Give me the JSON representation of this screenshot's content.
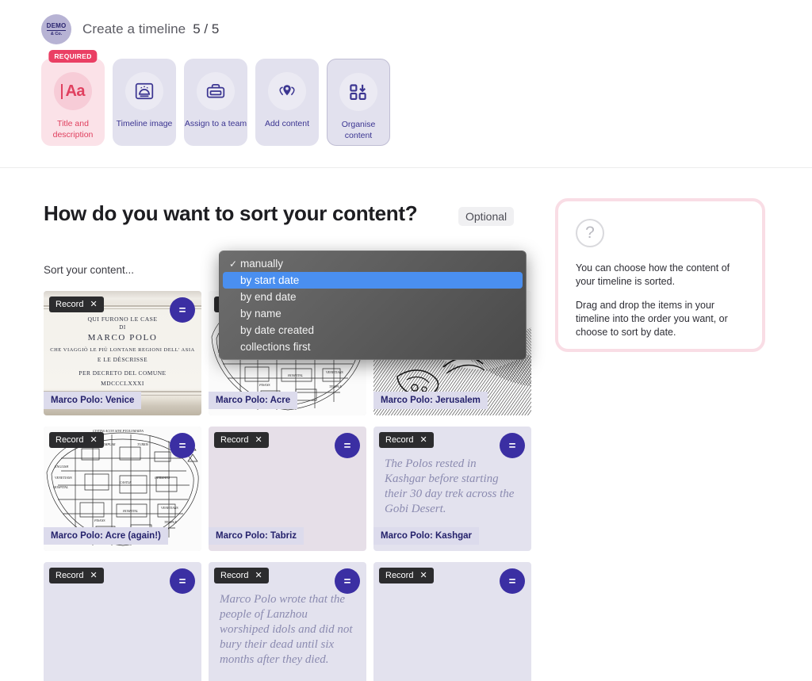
{
  "header": {
    "logo_demo": "DEMO",
    "logo_co": "& Co.",
    "title": "Create a timeline",
    "count": "5 / 5"
  },
  "steps": [
    {
      "label": "Title and description",
      "badge": "REQUIRED",
      "icon": "text-aa-icon",
      "state": "required"
    },
    {
      "label": "Timeline image",
      "badge": "",
      "icon": "image-sunrise-icon",
      "state": "default"
    },
    {
      "label": "Assign to a team",
      "badge": "",
      "icon": "briefcase-icon",
      "state": "default"
    },
    {
      "label": "Add content",
      "badge": "",
      "icon": "map-pins-icon",
      "state": "default"
    },
    {
      "label": "Organise content",
      "badge": "",
      "icon": "grid-download-icon",
      "state": "active"
    }
  ],
  "main": {
    "page_title": "How do you want to sort your content?",
    "optional_badge": "Optional",
    "sort_label": "Sort your content..."
  },
  "help": {
    "icon": "question-mark-icon",
    "paragraphs": [
      "You can choose how the content of your timeline is sorted.",
      "Drag and drop the items in your timeline into the order you want, or choose to sort by date."
    ]
  },
  "dropdown": {
    "open": true,
    "options": [
      {
        "label": "manually",
        "checked": true,
        "highlighted": false
      },
      {
        "label": "by start date",
        "checked": false,
        "highlighted": true
      },
      {
        "label": "by end date",
        "checked": false,
        "highlighted": false
      },
      {
        "label": "by name",
        "checked": false,
        "highlighted": false
      },
      {
        "label": "by date created",
        "checked": false,
        "highlighted": false
      },
      {
        "label": "collections first",
        "checked": false,
        "highlighted": false
      }
    ]
  },
  "cards": {
    "badge_label": "Record",
    "badge_close": "✕",
    "drag_handle_glyph": "=",
    "items": [
      {
        "caption": "Marco Polo: Venice",
        "art": "plaque",
        "quote": ""
      },
      {
        "caption": "Marco Polo: Acre",
        "art": "engrave-map-acre",
        "quote": ""
      },
      {
        "caption": "Marco Polo: Jerusalem",
        "art": "engrave-hatch",
        "quote": ""
      },
      {
        "caption": "Marco Polo: Acre (again!)",
        "art": "engrave-map-acre",
        "quote": ""
      },
      {
        "caption": "Marco Polo: Tabriz",
        "art": "blank-mauve",
        "quote": ""
      },
      {
        "caption": "Marco Polo: Kashgar",
        "art": "blank-lavender",
        "quote": "The Polos rested in Kashgar before starting their 30 day trek across the Gobi Desert."
      },
      {
        "caption": "",
        "art": "blank-lavender",
        "quote": ""
      },
      {
        "caption": "",
        "art": "blank-lavender",
        "quote": "Marco Polo wrote that the people of Lanzhou worshiped idols and did not bury their dead until six months after they died."
      },
      {
        "caption": "",
        "art": "blank-lavender",
        "quote": ""
      }
    ]
  },
  "plaque_text": {
    "lines": [
      "QUI FURONO LE CASE",
      "DI",
      "MARCO POLO",
      "CHE VIAGGIÒ LE PIÙ LONTANE REGIONI DELL' ASIA",
      "E LE DÈSCRISSE",
      "PER DECRETO DEL COMUNE",
      "MDCCCLXXXI"
    ]
  },
  "engrave_caption": "CIVITAS ACON SIVE PTOLOMAIDA",
  "colors": {
    "accent_indigo": "#3b2fa3",
    "accent_pink": "#ea3f64",
    "step_label_blue": "#3b3591",
    "highlight_blue": "#4a8ff0",
    "card_bg": "#e3e2ee"
  }
}
